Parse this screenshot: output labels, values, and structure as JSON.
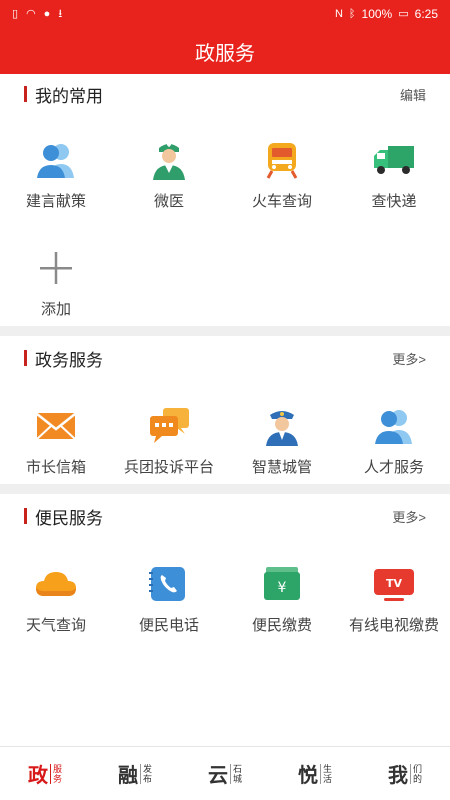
{
  "status_bar": {
    "battery": "100%",
    "time": "6:25"
  },
  "header": {
    "title": "政服务"
  },
  "my_common": {
    "title": "我的常用",
    "action": "编辑",
    "items": [
      {
        "label": "建言献策",
        "icon": "users-icon"
      },
      {
        "label": "微医",
        "icon": "doctor-icon"
      },
      {
        "label": "火车查询",
        "icon": "train-icon"
      },
      {
        "label": "查快递",
        "icon": "truck-icon"
      },
      {
        "label": "添加",
        "icon": "plus-icon"
      }
    ]
  },
  "gov_services": {
    "title": "政务服务",
    "more": "更多>",
    "items": [
      {
        "label": "市长信箱",
        "icon": "mail-icon"
      },
      {
        "label": "兵团投诉平台",
        "icon": "chat-icon"
      },
      {
        "label": "智慧城管",
        "icon": "officer-icon"
      },
      {
        "label": "人才服务",
        "icon": "users-icon"
      }
    ]
  },
  "public_services": {
    "title": "便民服务",
    "more": "更多>",
    "items": [
      {
        "label": "天气查询",
        "icon": "cloud-icon"
      },
      {
        "label": "便民电话",
        "icon": "phone-icon"
      },
      {
        "label": "便民缴费",
        "icon": "wallet-icon"
      },
      {
        "label": "有线电视缴费",
        "icon": "tv-icon"
      }
    ]
  },
  "tabs": [
    {
      "big": "政",
      "small1": "服",
      "small2": "务",
      "active": true
    },
    {
      "big": "融",
      "small1": "发",
      "small2": "布",
      "active": false
    },
    {
      "big": "云",
      "small1": "石",
      "small2": "城",
      "active": false
    },
    {
      "big": "悦",
      "small1": "生",
      "small2": "活",
      "active": false
    },
    {
      "big": "我",
      "small1": "们",
      "small2": "的",
      "active": false
    }
  ],
  "colors": {
    "brand_red": "#e8231d",
    "accent_red": "#c8221c"
  }
}
